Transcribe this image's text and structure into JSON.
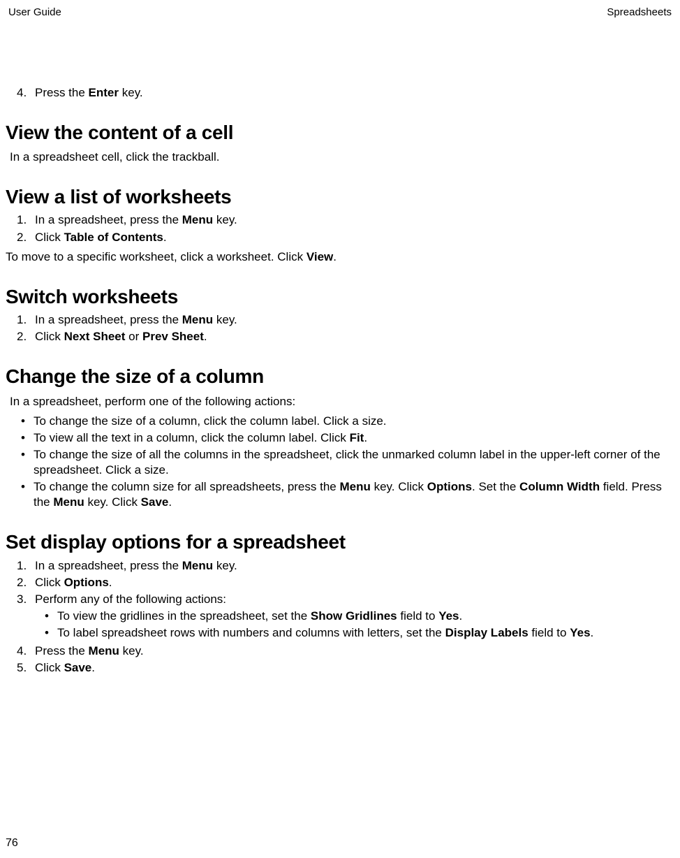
{
  "header": {
    "left": "User Guide",
    "right": "Spreadsheets"
  },
  "step4": {
    "num": "4.",
    "t1": "Press the ",
    "b1": "Enter",
    "t2": " key."
  },
  "s1": {
    "heading": "View the content of a cell",
    "p1": "In a spreadsheet cell, click the trackball."
  },
  "s2": {
    "heading": "View a list of worksheets",
    "i1": {
      "num": "1.",
      "t1": "In a spreadsheet, press the ",
      "b1": "Menu",
      "t2": " key."
    },
    "i2": {
      "num": "2.",
      "t1": "Click ",
      "b1": "Table of Contents",
      "t2": "."
    },
    "p_t1": "To move to a specific worksheet, click a worksheet. Click ",
    "p_b1": "View",
    "p_t2": "."
  },
  "s3": {
    "heading": "Switch worksheets",
    "i1": {
      "num": "1.",
      "t1": "In a spreadsheet, press the ",
      "b1": "Menu",
      "t2": " key."
    },
    "i2": {
      "num": "2.",
      "t1": "Click ",
      "b1": "Next Sheet",
      "t2": " or ",
      "b2": "Prev Sheet",
      "t3": "."
    }
  },
  "s4": {
    "heading": "Change the size of a column",
    "intro": "In a spreadsheet, perform one of the following actions:",
    "b1": "To change the size of a column, click the column label. Click a size.",
    "b2_t1": "To view all the text in a column, click the column label. Click ",
    "b2_b1": "Fit",
    "b2_t2": ".",
    "b3": "To change the size of all the columns in the spreadsheet, click the unmarked column label in the upper-left corner of the spreadsheet. Click a size.",
    "b4_t1": "To change the column size for all spreadsheets, press the ",
    "b4_b1": "Menu",
    "b4_t2": " key. Click ",
    "b4_b2": "Options",
    "b4_t3": ". Set the ",
    "b4_b3": "Column Width",
    "b4_t4": " field. Press the ",
    "b4_b4": "Menu",
    "b4_t5": " key. Click ",
    "b4_b5": "Save",
    "b4_t6": "."
  },
  "s5": {
    "heading": "Set display options for a spreadsheet",
    "i1": {
      "num": "1.",
      "t1": "In a spreadsheet, press the ",
      "b1": "Menu",
      "t2": " key."
    },
    "i2": {
      "num": "2.",
      "t1": "Click ",
      "b1": "Options",
      "t2": "."
    },
    "i3": {
      "num": "3.",
      "t1": "Perform any of the following actions:"
    },
    "sb1_t1": "To view the gridlines in the spreadsheet, set the ",
    "sb1_b1": "Show Gridlines",
    "sb1_t2": " field to ",
    "sb1_b2": "Yes",
    "sb1_t3": ".",
    "sb2_t1": "To label spreadsheet rows with numbers and columns with letters, set the ",
    "sb2_b1": "Display Labels",
    "sb2_t2": " field to ",
    "sb2_b2": "Yes",
    "sb2_t3": ".",
    "i4": {
      "num": "4.",
      "t1": "Press the ",
      "b1": "Menu",
      "t2": " key."
    },
    "i5": {
      "num": "5.",
      "t1": "Click ",
      "b1": "Save",
      "t2": "."
    }
  },
  "pagenum": "76"
}
